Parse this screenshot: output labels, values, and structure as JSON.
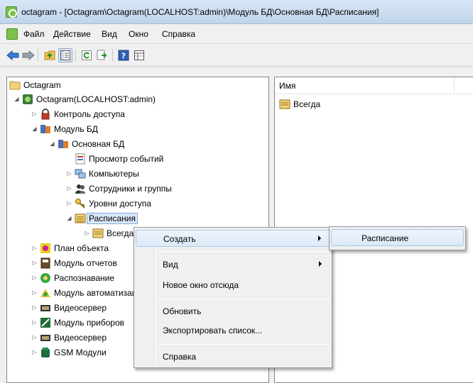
{
  "window": {
    "title": "octagram - [Octagram\\Octagram(LOCALHOST:admin)\\Модуль БД\\Основная БД\\Расписания]"
  },
  "menubar": {
    "items": [
      "Файл",
      "Действие",
      "Вид",
      "Окно",
      "Справка"
    ]
  },
  "toolbar": {
    "icons": [
      "back-arrow-icon",
      "forward-arrow-icon",
      "up-folder-icon",
      "show-tree-icon",
      "refresh-icon",
      "export-icon",
      "help-icon",
      "details-icon"
    ]
  },
  "tree": {
    "nodes": [
      {
        "label": "Octagram",
        "icon": "folder-icon"
      },
      {
        "label": "Octagram(LOCALHOST:admin)",
        "icon": "server-icon"
      },
      {
        "label": "Контроль доступа",
        "icon": "lock-icon"
      },
      {
        "label": "Модуль БД",
        "icon": "database-module-icon"
      },
      {
        "label": "Основная БД",
        "icon": "database-icon"
      },
      {
        "label": "Просмотр событий",
        "icon": "event-viewer-icon"
      },
      {
        "label": "Компьютеры",
        "icon": "computers-icon"
      },
      {
        "label": "Сотрудники и группы",
        "icon": "users-icon"
      },
      {
        "label": "Уровни доступа",
        "icon": "keys-icon"
      },
      {
        "label": "Расписания",
        "icon": "schedule-icon"
      },
      {
        "label": "Всегда",
        "icon": "schedule-item-icon"
      },
      {
        "label": "План объекта",
        "icon": "floor-plan-icon"
      },
      {
        "label": "Модуль отчетов",
        "icon": "reports-icon"
      },
      {
        "label": "Распознавание",
        "icon": "recognition-icon"
      },
      {
        "label": "Модуль автоматизации",
        "icon": "automation-icon"
      },
      {
        "label": "Видеосервер",
        "icon": "video-server-icon"
      },
      {
        "label": "Модуль приборов",
        "icon": "devices-icon"
      },
      {
        "label": "Видеосервер",
        "icon": "video-server-icon"
      },
      {
        "label": "GSM Модули",
        "icon": "gsm-icon"
      }
    ]
  },
  "list": {
    "column_name": "Имя",
    "items": [
      {
        "label": "Всегда",
        "icon": "schedule-item-icon"
      }
    ]
  },
  "context_menu": {
    "items": [
      "Создать",
      "Вид",
      "Новое окно отсюда",
      "Обновить",
      "Экспортировать список...",
      "Справка"
    ]
  },
  "submenu": {
    "items": [
      "Расписание"
    ]
  },
  "colors": {
    "selection": "#d9e8f9",
    "highlight_border": "#a8c8ec",
    "titlebar": "#c9dcf0"
  }
}
